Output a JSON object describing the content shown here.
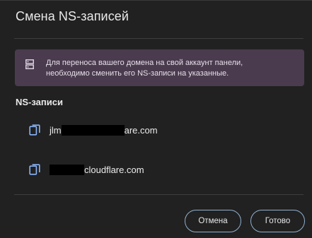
{
  "dialog": {
    "title": "Смена NS-записей",
    "notice": {
      "icon": "server-icon",
      "line1": "Для переноса вашего домена на свой аккаунт панели,",
      "line2": "необходимо сменить его NS-записи на указанные."
    },
    "section_title": "NS-записи",
    "ns_records": [
      {
        "visible_prefix": "jlm",
        "visible_suffix": "are.com",
        "redacted": true,
        "icon": "copy-icon"
      },
      {
        "visible_prefix": "",
        "visible_suffix": "cloudflare.com",
        "redacted": true,
        "icon": "copy-icon"
      }
    ],
    "buttons": {
      "cancel": "Отмена",
      "done": "Готово"
    }
  },
  "colors": {
    "background": "#212121",
    "notice_background": "#4a3b4e",
    "icon_accent": "#8ab4f8",
    "button_border": "#8fb0cf",
    "divider": "#3d3d3d"
  }
}
